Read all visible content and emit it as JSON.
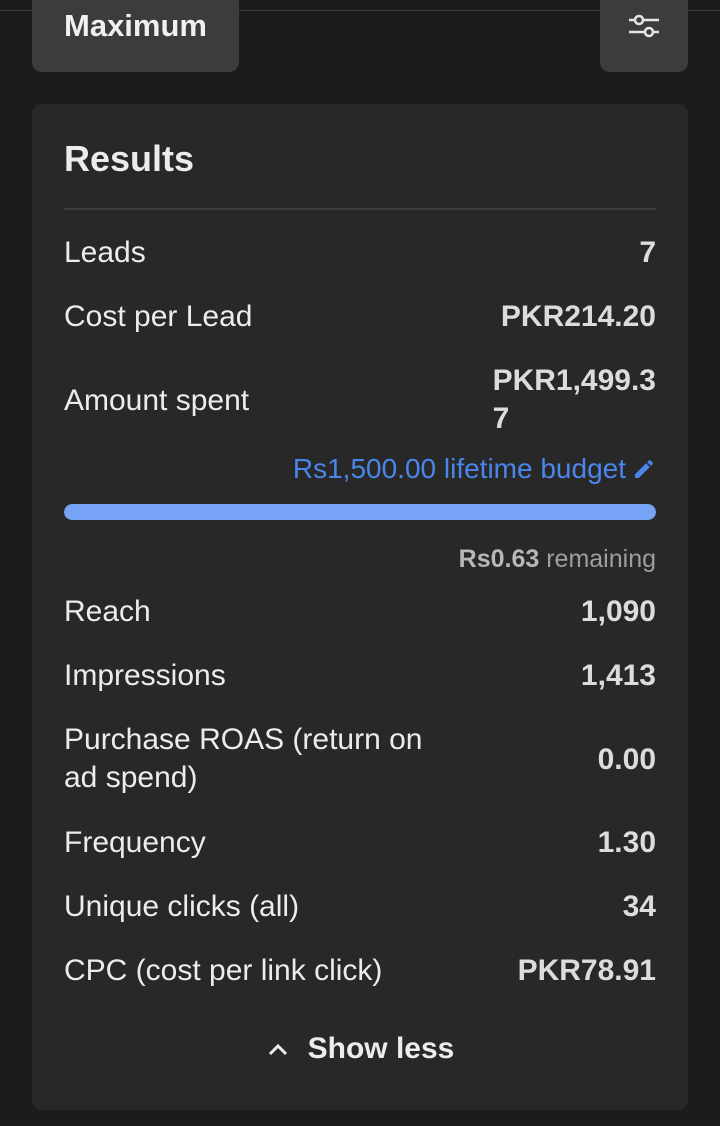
{
  "top": {
    "max_label": "Maximum",
    "filter_icon": "filter-sliders-icon"
  },
  "results": {
    "title": "Results",
    "leads": {
      "label": "Leads",
      "value": "7"
    },
    "cost_per_lead": {
      "label": "Cost per Lead",
      "value": "PKR214.20"
    },
    "amount_spent": {
      "label": "Amount spent",
      "value_line1": "PKR1,499.3",
      "value_line2": "7"
    },
    "budget": {
      "text": "Rs1,500.00 lifetime budget",
      "icon": "pencil-edit-icon"
    },
    "progress_fraction": 0.9996,
    "remaining": {
      "amount": "Rs0.63",
      "suffix": "remaining"
    },
    "reach": {
      "label": "Reach",
      "value": "1,090"
    },
    "impressions": {
      "label": "Impressions",
      "value": "1,413"
    },
    "roas": {
      "label_line1": "Purchase ROAS (return on",
      "label_line2": "ad spend)",
      "value": "0.00"
    },
    "frequency": {
      "label": "Frequency",
      "value": "1.30"
    },
    "unique_clicks": {
      "label": "Unique clicks (all)",
      "value": "34"
    },
    "cpc": {
      "label": "CPC (cost per link click)",
      "value": "PKR78.91"
    }
  },
  "footer": {
    "show_less_label": "Show less",
    "chevron_icon": "chevron-up-icon"
  },
  "colors": {
    "accent": "#4a86ea",
    "progress": "#76a3f5",
    "card": "#282828",
    "background": "#1c1c1c"
  }
}
